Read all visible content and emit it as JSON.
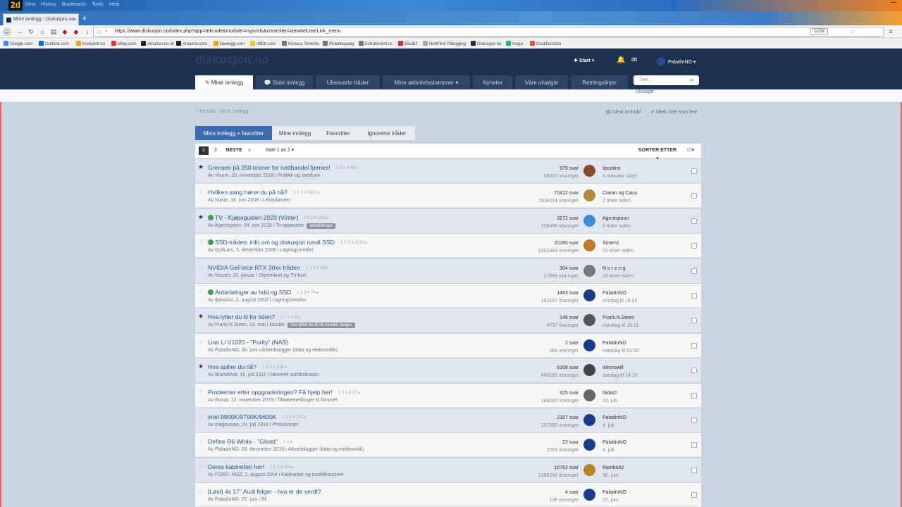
{
  "browser": {
    "menus": [
      "View",
      "History",
      "Bookmarks",
      "Tools",
      "Help"
    ],
    "tab_title": "Mine innlegg - Diskusjon.no",
    "url": "https://www.diskusjon.no/index.php?app=tekcode&module=myposts&controller=view#elUserLink_menu",
    "zoom": "110%",
    "bookmarks": [
      "Google.com",
      "Outlook.com",
      "Komplett.no",
      "eBay.com",
      "Amazon.co.uk",
      "Amazon.com",
      "Newegg.com",
      "IMDb.com",
      "Kickass Torrents",
      "Piratebaysøg",
      "Extratorrent.cc",
      "EikaBT",
      "NettFlink Pålogging",
      "Diskusjon.no",
      "Imgur",
      "DuckDuckGo"
    ]
  },
  "site": {
    "logo": "diskusjon.no",
    "start_label": "Start",
    "username": "PaladinNO",
    "nav_tabs": [
      "Mine innlegg",
      "Siste innlegg",
      "Ubesvarte tråder",
      "Mine aktivitetsstrømmer",
      "Nyheter",
      "Våre utvalgte",
      "Retningslinjer"
    ],
    "search_placeholder": "Søk...",
    "sub_text": "Utvalgte"
  },
  "breadcrumb": [
    "Forside",
    "Mine innlegg"
  ],
  "actions": {
    "unread": "Ulest innhold",
    "mark_read": "Merk side som lest"
  },
  "filter_tabs": [
    "Mine innlegg + favoritter",
    "Mine innlegg",
    "Favoritter",
    "Ignorerte tråder"
  ],
  "pager": {
    "p1": "1",
    "p2": "2",
    "next": "NESTE",
    "last": "»",
    "page_of": "Side 1 av 2",
    "sort": "SORTER ETTER"
  },
  "topics": [
    {
      "title": "Grensen på 350 kroner for netthandel fjernes!",
      "starred": true,
      "pinned": false,
      "pages": "1 2 3 4 49",
      "meta": "Av Visum, 20. november 2018 i Politikk og samfunn",
      "tag": "",
      "replies": "979 svar",
      "views": "50025 visninger",
      "last_user": "ilpostino",
      "last_time": "8 minutter siden",
      "avatar_color": "#8a4a2c",
      "highlight": true
    },
    {
      "title": "Hvilken sang hører du på nå?",
      "starred": false,
      "pinned": false,
      "pages": "1 2 3 4 3522",
      "meta": "Av Nipoe, 16. juni 2008 i Lekeplassen",
      "tag": "",
      "replies": "70422 svar",
      "views": "2434114 visninger",
      "last_user": "Ciaran og Ciara",
      "last_time": "2 timer siden",
      "avatar_color": "#b48a3c",
      "highlight": false
    },
    {
      "title": "TV - Kjøpsguiden 2020 (Vinter)",
      "starred": true,
      "pinned": true,
      "pages": "1 2 3 4 164",
      "meta": "Av Agentspoon, 24. juni 2018 i Tv-apparater",
      "tag": "anbefalinger",
      "replies": "3272 svar",
      "views": "196486 visninger",
      "last_user": "Agentspoon",
      "last_time": "5 timer siden",
      "avatar_color": "#3a8fd8",
      "highlight": true
    },
    {
      "title": "SSD-tråden: info om og diskusjon rundt SSD",
      "starred": false,
      "pinned": true,
      "pages": "1 2 3 4 1015",
      "meta": "Av GullLars, 3. desember 2008 i Lagringsmedier",
      "tag": "",
      "replies": "20280 svar",
      "views": "1401383 visninger",
      "last_user": "Simen1",
      "last_time": "15 timer siden",
      "avatar_color": "#c07a2a",
      "highlight": false
    },
    {
      "title": "NVIDIA GeForce RTX 30xx tråden",
      "starred": false,
      "pinned": false,
      "pages": "1 2 3 4 16",
      "meta": "Av Nizzen, 20. januar i Skjermkort og TV-kort",
      "tag": "",
      "replies": "304 svar",
      "views": "17089 visninger",
      "last_user": "N o r e n g",
      "last_time": "16 timer siden",
      "avatar_color": "#7a7a7a",
      "highlight": true
    },
    {
      "title": "Anbefalinger av hdd og SSD",
      "starred": false,
      "pinned": true,
      "pages": "1 2 3 4 74",
      "meta": "Av ilpostino, 2. august 2002 i Lagringsmedier",
      "tag": "",
      "replies": "1463 svar",
      "views": "162187 visninger",
      "last_user": "PaladinNO",
      "last_time": "onsdag kl 16:20",
      "avatar_color": "#1a3a8a",
      "highlight": false
    },
    {
      "title": "Hva lytter du til for tiden?",
      "starred": true,
      "pinned": false,
      "pages": "1 2 3 4 8",
      "meta": "Av Frank.N.Steen, 23. mai i Musikk",
      "tag": "hva lytter du til nå musikk sanger",
      "replies": "148 svar",
      "views": "4707 visninger",
      "last_user": "Frank.N.Steen",
      "last_time": "mandag kl 16:11",
      "avatar_color": "#555555",
      "highlight": true
    },
    {
      "title": "Lian Li V1020 - \"Purity\" (NAS)",
      "starred": false,
      "pinned": false,
      "pages": "",
      "meta": "Av PaladinNO, 30. juni i Arbeidslogger (data og elektronikk)",
      "tag": "",
      "replies": "2 svar",
      "views": "266 visninger",
      "last_user": "PaladinNO",
      "last_time": "mandag kl 01:50",
      "avatar_color": "#1a3a8a",
      "highlight": false
    },
    {
      "title": "Hva spiller du nå?",
      "starred": true,
      "pinned": false,
      "pages": "1 2 3 4 316",
      "meta": "Av Brandshal, 16. juli 2011 i Generell spilldiskusjon",
      "tag": "",
      "replies": "6308 svar",
      "views": "408182 visninger",
      "last_user": "Winnowill",
      "last_time": "søndag kl 14:13",
      "avatar_color": "#444444",
      "highlight": true
    },
    {
      "title": "Problemer etter oppgraderingen? Få hjelp her!",
      "starred": false,
      "pinned": false,
      "pages": "1 2 3 4 17",
      "meta": "Av Runar, 12. november 2019 i Tilbakemeldinger til forumet",
      "tag": "",
      "replies": "325 svar",
      "views": "186220 visninger",
      "last_user": "Nidar2",
      "last_time": "10. juli",
      "avatar_color": "#666666",
      "highlight": false
    },
    {
      "title": "intel 9900K/9700K/9600K",
      "starred": false,
      "pinned": false,
      "pages": "1 2 3 4 120",
      "meta": "Av magnusavr, 24. juli 2018 i Prosessorer",
      "tag": "",
      "replies": "2387 svar",
      "views": "107562 visninger",
      "last_user": "PaladinNO",
      "last_time": "4. juli",
      "avatar_color": "#1a3a8a",
      "highlight": true
    },
    {
      "title": "Define R6 White - \"Ghost\"",
      "starred": false,
      "pinned": false,
      "pages": "1 2",
      "meta": "Av PaladinNO, 28. desember 2019 i Arbeidslogger (data og elektronikk)",
      "tag": "",
      "replies": "23 svar",
      "views": "2253 visninger",
      "last_user": "PaladinNO",
      "last_time": "4. juli",
      "avatar_color": "#1a3a8a",
      "highlight": false
    },
    {
      "title": "Deres kabinetter her!",
      "starred": false,
      "pinned": false,
      "pages": "1 2 3 4 839",
      "meta": "Av FORD..NOZ, 1. august 2004 i Kabinetter og modifikasjoner",
      "tag": "",
      "replies": "16763 svar",
      "views": "1388242 visninger",
      "last_user": "Rambo82",
      "last_time": "30. juni",
      "avatar_color": "#b8862a",
      "highlight": true
    },
    {
      "title": "[Løst] 4x 17\" Audi felger - hva er de verdt?",
      "starred": false,
      "pinned": false,
      "pages": "",
      "meta": "Av PaladinNO, 27. juni i Bil",
      "tag": "",
      "replies": "4 svar",
      "views": "138 visninger",
      "last_user": "PaladinNO",
      "last_time": "27. juni",
      "avatar_color": "#1a3a8a",
      "highlight": false
    }
  ]
}
